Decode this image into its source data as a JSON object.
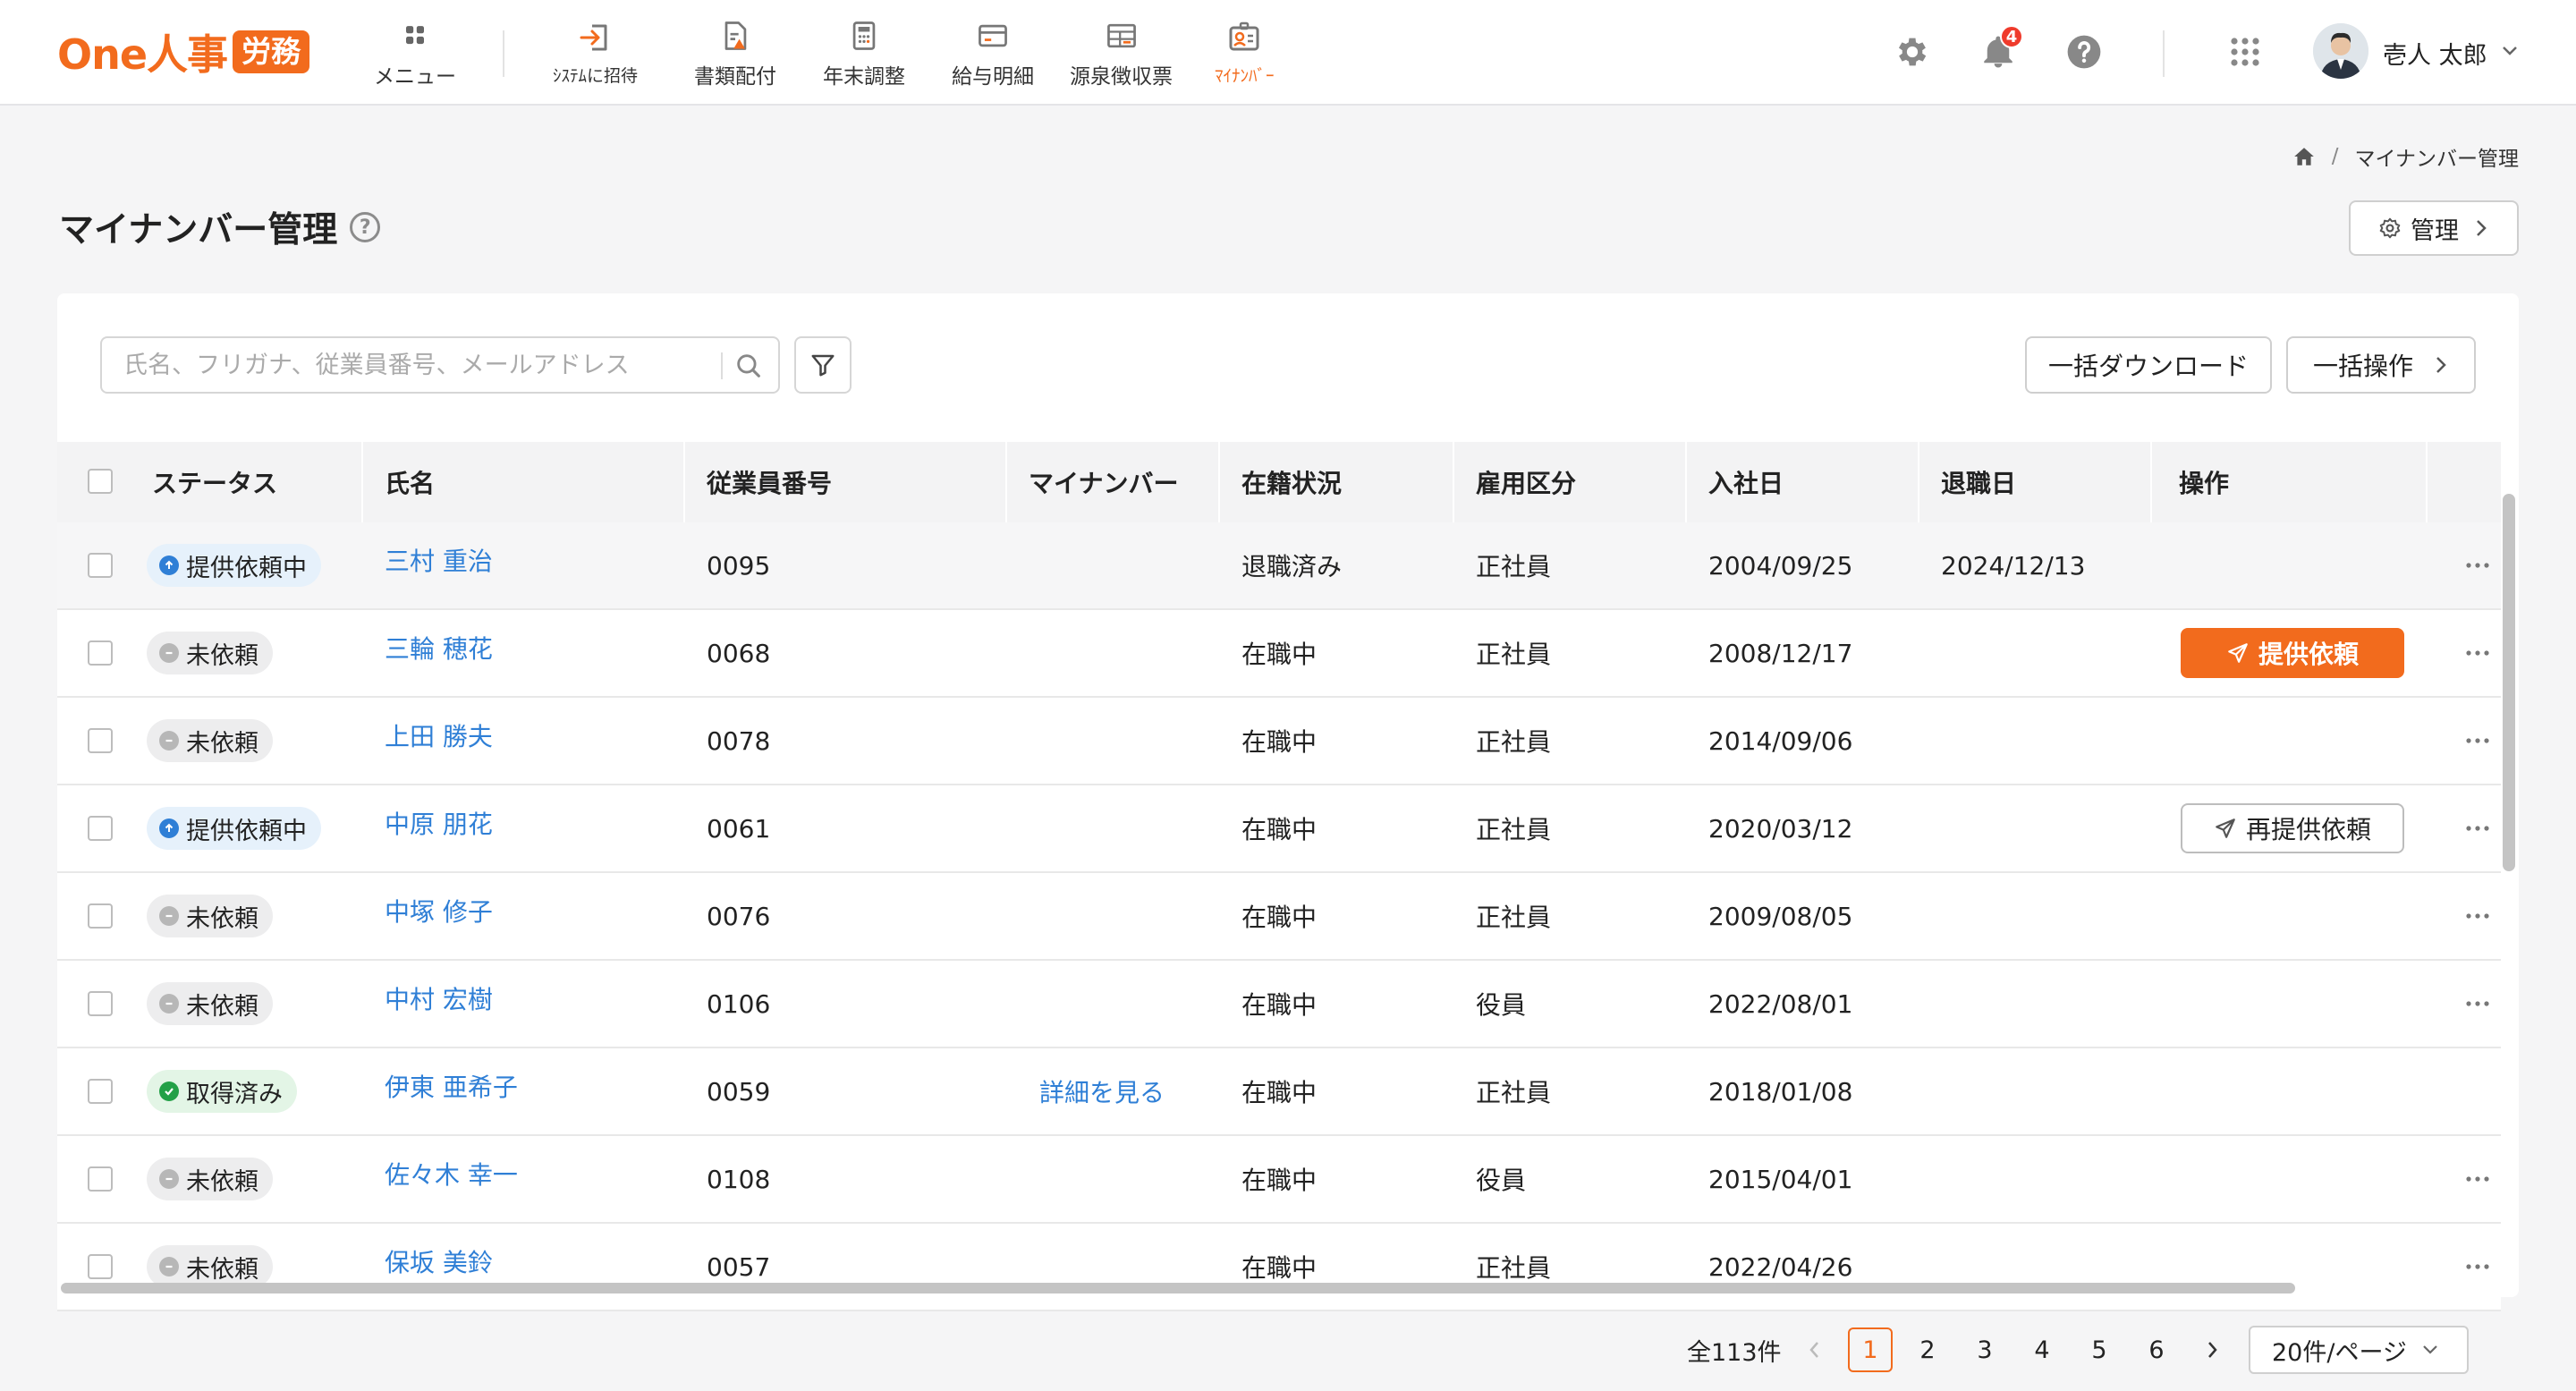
{
  "app": {
    "logo_text": "One人事",
    "logo_badge": "労務"
  },
  "nav": {
    "menu": "メニュー",
    "invite": "ｼｽﾃﾑに招待",
    "documents": "書類配付",
    "year_end": "年末調整",
    "payslip": "給与明細",
    "withholding": "源泉徴収票",
    "mynumber": "ﾏｲﾅﾝﾊﾞｰ"
  },
  "header": {
    "notification_count": "4",
    "username": "壱人 太郎"
  },
  "breadcrumb": {
    "current": "マイナンバー管理"
  },
  "page": {
    "title": "マイナンバー管理",
    "help": "?",
    "manage_button": "管理"
  },
  "toolbar": {
    "search_placeholder": "氏名、フリガナ、従業員番号、メールアドレス",
    "bulk_download": "一括ダウンロード",
    "bulk_action": "一括操作"
  },
  "table": {
    "columns": [
      "ステータス",
      "氏名",
      "従業員番号",
      "マイナンバー",
      "在籍状況",
      "雇用区分",
      "入社日",
      "退職日",
      "操作"
    ],
    "rows": [
      {
        "status": "提供依頼中",
        "status_type": "pending",
        "name": "三村 重治",
        "emp_no": "0095",
        "mynumber": "",
        "employment": "退職済み",
        "type": "正社員",
        "joined": "2004/09/25",
        "retired": "2024/12/13",
        "action": "",
        "more": true
      },
      {
        "status": "未依頼",
        "status_type": "none",
        "name": "三輪 穂花",
        "emp_no": "0068",
        "mynumber": "",
        "employment": "在職中",
        "type": "正社員",
        "joined": "2008/12/17",
        "retired": "",
        "action": "提供依頼",
        "action_type": "primary",
        "more": true
      },
      {
        "status": "未依頼",
        "status_type": "none",
        "name": "上田 勝夫",
        "emp_no": "0078",
        "mynumber": "",
        "employment": "在職中",
        "type": "正社員",
        "joined": "2014/09/06",
        "retired": "",
        "action": "",
        "more": true
      },
      {
        "status": "提供依頼中",
        "status_type": "pending",
        "name": "中原 朋花",
        "emp_no": "0061",
        "mynumber": "",
        "employment": "在職中",
        "type": "正社員",
        "joined": "2020/03/12",
        "retired": "",
        "action": "再提供依頼",
        "action_type": "secondary",
        "more": true
      },
      {
        "status": "未依頼",
        "status_type": "none",
        "name": "中塚 修子",
        "emp_no": "0076",
        "mynumber": "",
        "employment": "在職中",
        "type": "正社員",
        "joined": "2009/08/05",
        "retired": "",
        "action": "",
        "more": true
      },
      {
        "status": "未依頼",
        "status_type": "none",
        "name": "中村 宏樹",
        "emp_no": "0106",
        "mynumber": "",
        "employment": "在職中",
        "type": "役員",
        "joined": "2022/08/01",
        "retired": "",
        "action": "",
        "more": true
      },
      {
        "status": "取得済み",
        "status_type": "done",
        "name": "伊東 亜希子",
        "emp_no": "0059",
        "mynumber": "詳細を見る",
        "employment": "在職中",
        "type": "正社員",
        "joined": "2018/01/08",
        "retired": "",
        "action": "",
        "more": false
      },
      {
        "status": "未依頼",
        "status_type": "none",
        "name": "佐々木 幸一",
        "emp_no": "0108",
        "mynumber": "",
        "employment": "在職中",
        "type": "役員",
        "joined": "2015/04/01",
        "retired": "",
        "action": "",
        "more": true
      },
      {
        "status": "未依頼",
        "status_type": "none",
        "name": "保坂 美鈴",
        "emp_no": "0057",
        "mynumber": "",
        "employment": "在職中",
        "type": "正社員",
        "joined": "2022/04/26",
        "retired": "",
        "action": "",
        "more": true
      }
    ]
  },
  "pagination": {
    "total": "全113件",
    "pages": [
      "1",
      "2",
      "3",
      "4",
      "5",
      "6"
    ],
    "current": "1",
    "page_size": "20件/ページ"
  },
  "colors": {
    "accent": "#f26b1d",
    "link": "#2f7fd6",
    "pending": "#2f7fd6",
    "done": "#23a047",
    "badge": "#ef3b2c"
  }
}
